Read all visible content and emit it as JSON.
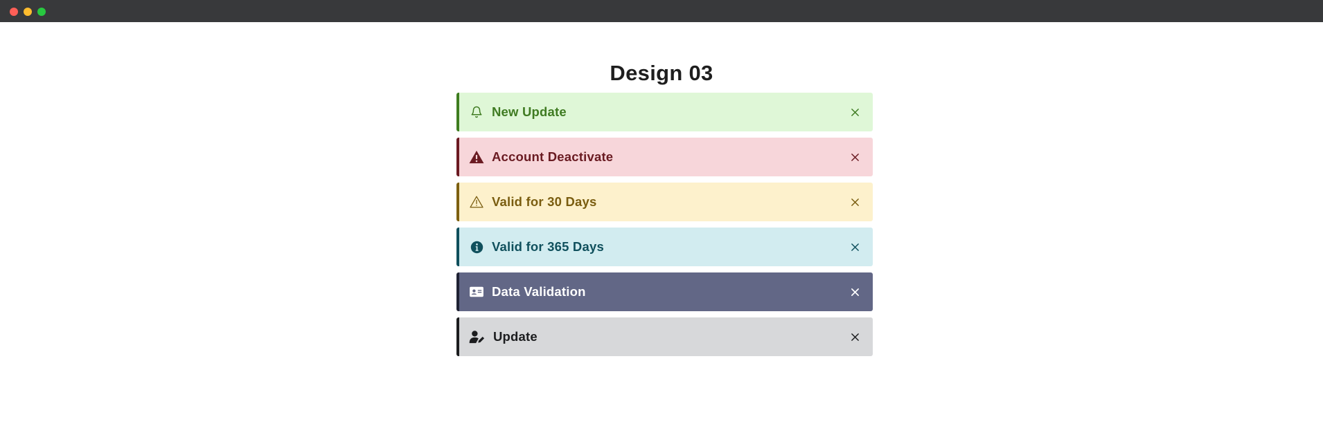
{
  "window": {
    "controls": [
      "close",
      "minimize",
      "maximize"
    ]
  },
  "page": {
    "title": "Design 03"
  },
  "alerts": [
    {
      "label": "New Update",
      "icon": "bell-icon",
      "bg": "#dff7d7",
      "border": "#3e7d1f",
      "text": "#3f7b22"
    },
    {
      "label": "Account Deactivate",
      "icon": "warning-filled-icon",
      "bg": "#f7d6da",
      "border": "#6b1a22",
      "text": "#6a1b22"
    },
    {
      "label": "Valid for 30 Days",
      "icon": "warning-outline-icon",
      "bg": "#fdf1cc",
      "border": "#7d6010",
      "text": "#7a5d10"
    },
    {
      "label": "Valid for 365 Days",
      "icon": "info-icon",
      "bg": "#d2ecf0",
      "border": "#0f4f5c",
      "text": "#10505d"
    },
    {
      "label": "Data Validation",
      "icon": "id-card-icon",
      "bg": "#626786",
      "border": "#1f2233",
      "text": "#ffffff"
    },
    {
      "label": "Update",
      "icon": "user-edit-icon",
      "bg": "#d7d8da",
      "border": "#1b1c1e",
      "text": "#1c1d1f"
    }
  ],
  "close_label": "×"
}
